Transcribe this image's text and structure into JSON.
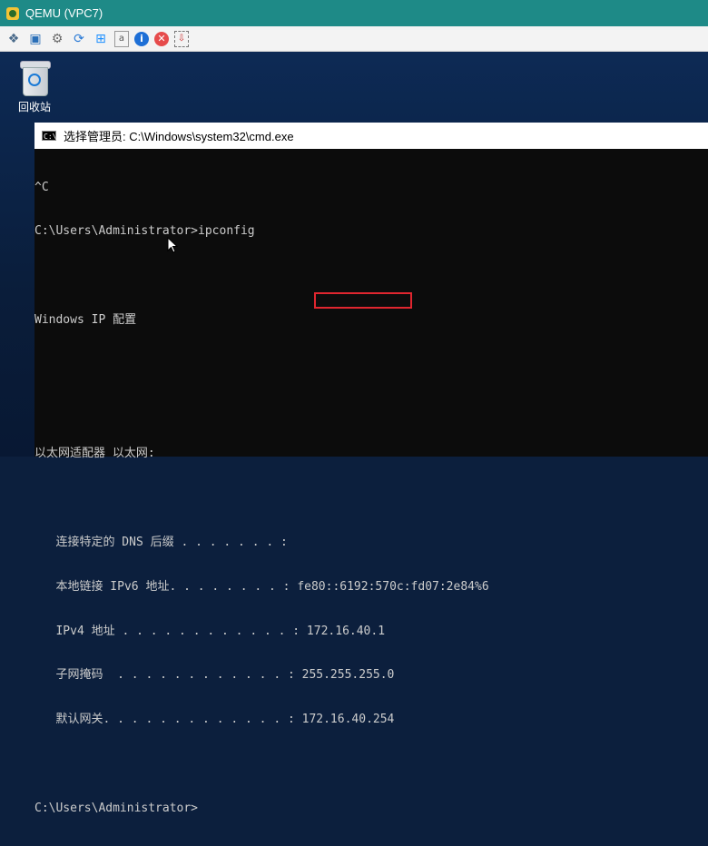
{
  "window": {
    "title": "QEMU (VPC7)"
  },
  "toolbar": {
    "icons": [
      "settings-icon",
      "fullscreen-icon",
      "gear-icon",
      "refresh-icon",
      "windows-icon",
      "text-icon",
      "info-icon",
      "close-icon",
      "screenshot-icon"
    ]
  },
  "desktop": {
    "recycle_label": "回收站"
  },
  "cmd": {
    "title": "选择管理员: C:\\Windows\\system32\\cmd.exe",
    "lines": [
      "^C",
      "C:\\Users\\Administrator>ipconfig",
      "",
      "Windows IP 配置",
      "",
      "",
      "以太网适配器 以太网:",
      "",
      "   连接特定的 DNS 后缀 . . . . . . . :",
      "   本地链接 IPv6 地址. . . . . . . . : fe80::6192:570c:fd07:2e84%6",
      "   IPv4 地址 . . . . . . . . . . . . : 172.16.40.1",
      "   子网掩码  . . . . . . . . . . . . : 255.255.255.0",
      "   默认网关. . . . . . . . . . . . . : 172.16.40.254",
      "",
      "C:\\Users\\Administrator>"
    ]
  }
}
